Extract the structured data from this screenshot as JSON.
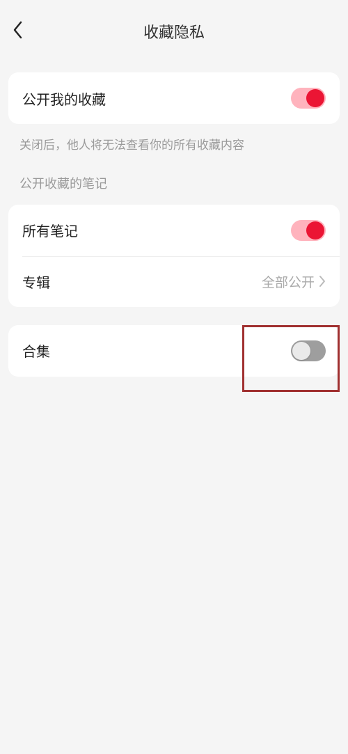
{
  "header": {
    "title": "收藏隐私"
  },
  "publicFavorites": {
    "label": "公开我的收藏",
    "hint": "关闭后，他人将无法查看你的所有收藏内容"
  },
  "sectionLabel": "公开收藏的笔记",
  "allNotes": {
    "label": "所有笔记"
  },
  "album": {
    "label": "专辑",
    "value": "全部公开"
  },
  "collection": {
    "label": "合集"
  }
}
